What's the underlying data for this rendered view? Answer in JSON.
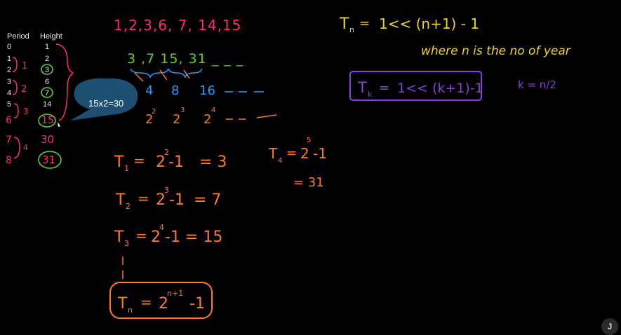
{
  "table": {
    "headers": [
      "Period",
      "Height"
    ],
    "rows": [
      {
        "period": "0",
        "height": "1"
      },
      {
        "period": "1",
        "height": "2"
      },
      {
        "period": "2",
        "height": "3"
      },
      {
        "period": "3",
        "height": "6"
      },
      {
        "period": "4",
        "height": "7"
      },
      {
        "period": "5",
        "height": "14"
      },
      {
        "period": "6",
        "height": "15"
      },
      {
        "period": "7",
        "height": "30"
      },
      {
        "period": "8",
        "height": "31"
      }
    ],
    "group_labels": [
      "1",
      "2",
      "3",
      "4"
    ]
  },
  "callout": "15x2=30",
  "sequence_top": "1,2,3,6, 7, 14,15",
  "sequence_odd": "3 ,7 15, 31 _ _ _",
  "sequence_pow": [
    "4",
    "8",
    "16"
  ],
  "sequence_exp": [
    {
      "base": "2",
      "exp": "2"
    },
    {
      "base": "2",
      "exp": "3"
    },
    {
      "base": "2",
      "exp": "4"
    }
  ],
  "equations": [
    {
      "lhs": "T",
      "sub": "1",
      "base": "2",
      "exp": "2",
      "rest": "-1",
      "result": "= 3"
    },
    {
      "lhs": "T",
      "sub": "2",
      "base": "2",
      "exp": "3",
      "rest": "-1",
      "result": "= 7"
    },
    {
      "lhs": "T",
      "sub": "3",
      "base": "2",
      "exp": "4",
      "rest": "-1 = 15",
      "result": ""
    }
  ],
  "boxed_general": {
    "lhs": "T",
    "sub": "n",
    "base": "2",
    "exp": "n+1",
    "rest": "-1"
  },
  "t4": {
    "lhs": "T",
    "sub": "4",
    "base": "2",
    "exp": "5",
    "rest": "-1",
    "result": "= 31"
  },
  "formula_tn": {
    "lhs": "T",
    "sub": "n",
    "rhs": "1<< (n+1) - 1"
  },
  "where_note": "where n is the no of year",
  "formula_tk": {
    "lhs": "T",
    "sub": "k",
    "rhs": "1<< (k+1)-1"
  },
  "k_note": "k = n/2",
  "user_initial": "J",
  "colors": {
    "pink": "#ff2b6e",
    "green": "#5fd02a",
    "blue": "#1f9bff",
    "orange": "#ff7a1a",
    "yellow": "#f2d21b",
    "purple": "#8a3fd6",
    "callout": "#1e4f73"
  }
}
